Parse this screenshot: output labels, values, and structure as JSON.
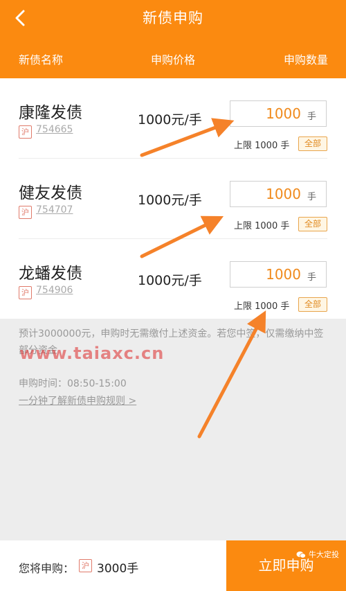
{
  "header": {
    "title": "新债申购",
    "columns": {
      "name": "新债名称",
      "price": "申购价格",
      "quantity": "申购数量"
    }
  },
  "bonds": [
    {
      "name": "康隆发债",
      "exchange": "沪",
      "code": "754665",
      "price": "1000元/手",
      "quantity": "1000",
      "unit": "手",
      "limit": "上限 1000 手",
      "all_label": "全部"
    },
    {
      "name": "健友发债",
      "exchange": "沪",
      "code": "754707",
      "price": "1000元/手",
      "quantity": "1000",
      "unit": "手",
      "limit": "上限 1000 手",
      "all_label": "全部"
    },
    {
      "name": "龙蟠发债",
      "exchange": "沪",
      "code": "754906",
      "price": "1000元/手",
      "quantity": "1000",
      "unit": "手",
      "limit": "上限 1000 手",
      "all_label": "全部"
    }
  ],
  "info": {
    "notice": "预计3000000元，申购时无需缴付上述资金。若您中签，仅需缴纳中签部分资金",
    "time": "申购时间：08:50-15:00",
    "rules_link": "一分钟了解新债申购规则 >",
    "watermark": "www.taiaxc.cn"
  },
  "bottom": {
    "label": "您将申购：",
    "exchange": "沪",
    "amount": "3000手",
    "submit": "立即申购",
    "corner_tag": "牛大定投"
  },
  "colors": {
    "accent": "#fb8a10",
    "quantity": "#f08a1c",
    "badge": "#e07a6a"
  }
}
